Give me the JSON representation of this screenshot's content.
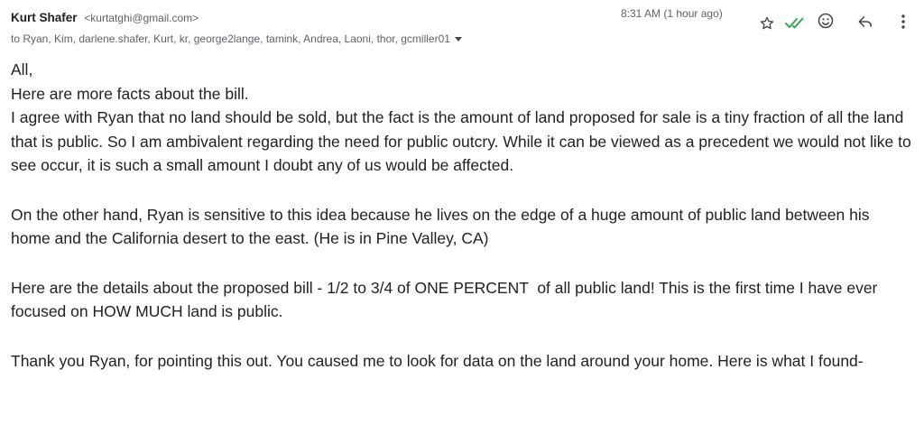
{
  "header": {
    "sender_name": "Kurt Shafer",
    "sender_email": "<kurtatghi@gmail.com>",
    "recipients": "to Ryan, Kim, darlene.shafer, Kurt, kr, george2lange, tamink, Andrea, Laoni, thor, gcmiller01",
    "timestamp": "8:31 AM (1 hour ago)"
  },
  "actions": {
    "icons": [
      "star-icon",
      "read-receipt-check-icon",
      "emoji-reaction-icon",
      "reply-icon",
      "more-options-icon"
    ],
    "check_color": "#34a853"
  },
  "body": {
    "greeting": "All,",
    "line1": "Here are more facts about the bill.",
    "para1": "I agree with Ryan that no land should be sold, but the fact is the amount of land proposed for sale is a tiny fraction of all the land that is public. So I am ambivalent regarding the need for public outcry. While it can be viewed as a precedent we would not like to see occur, it is such a small amount I doubt any of us would be affected.",
    "para2": "On the other hand, Ryan is sensitive to this idea because he lives on the edge of a huge amount of public land between his home and the California desert to the east. (He is in Pine Valley, CA)",
    "para3": "Here are the details about the proposed bill - 1/2 to 3/4 of ONE PERCENT  of all public land! This is the first time I have ever focused on HOW MUCH land is public.",
    "para4": "Thank you Ryan, for pointing this out. You caused me to look for data on the land around your home. Here is what I found-"
  }
}
